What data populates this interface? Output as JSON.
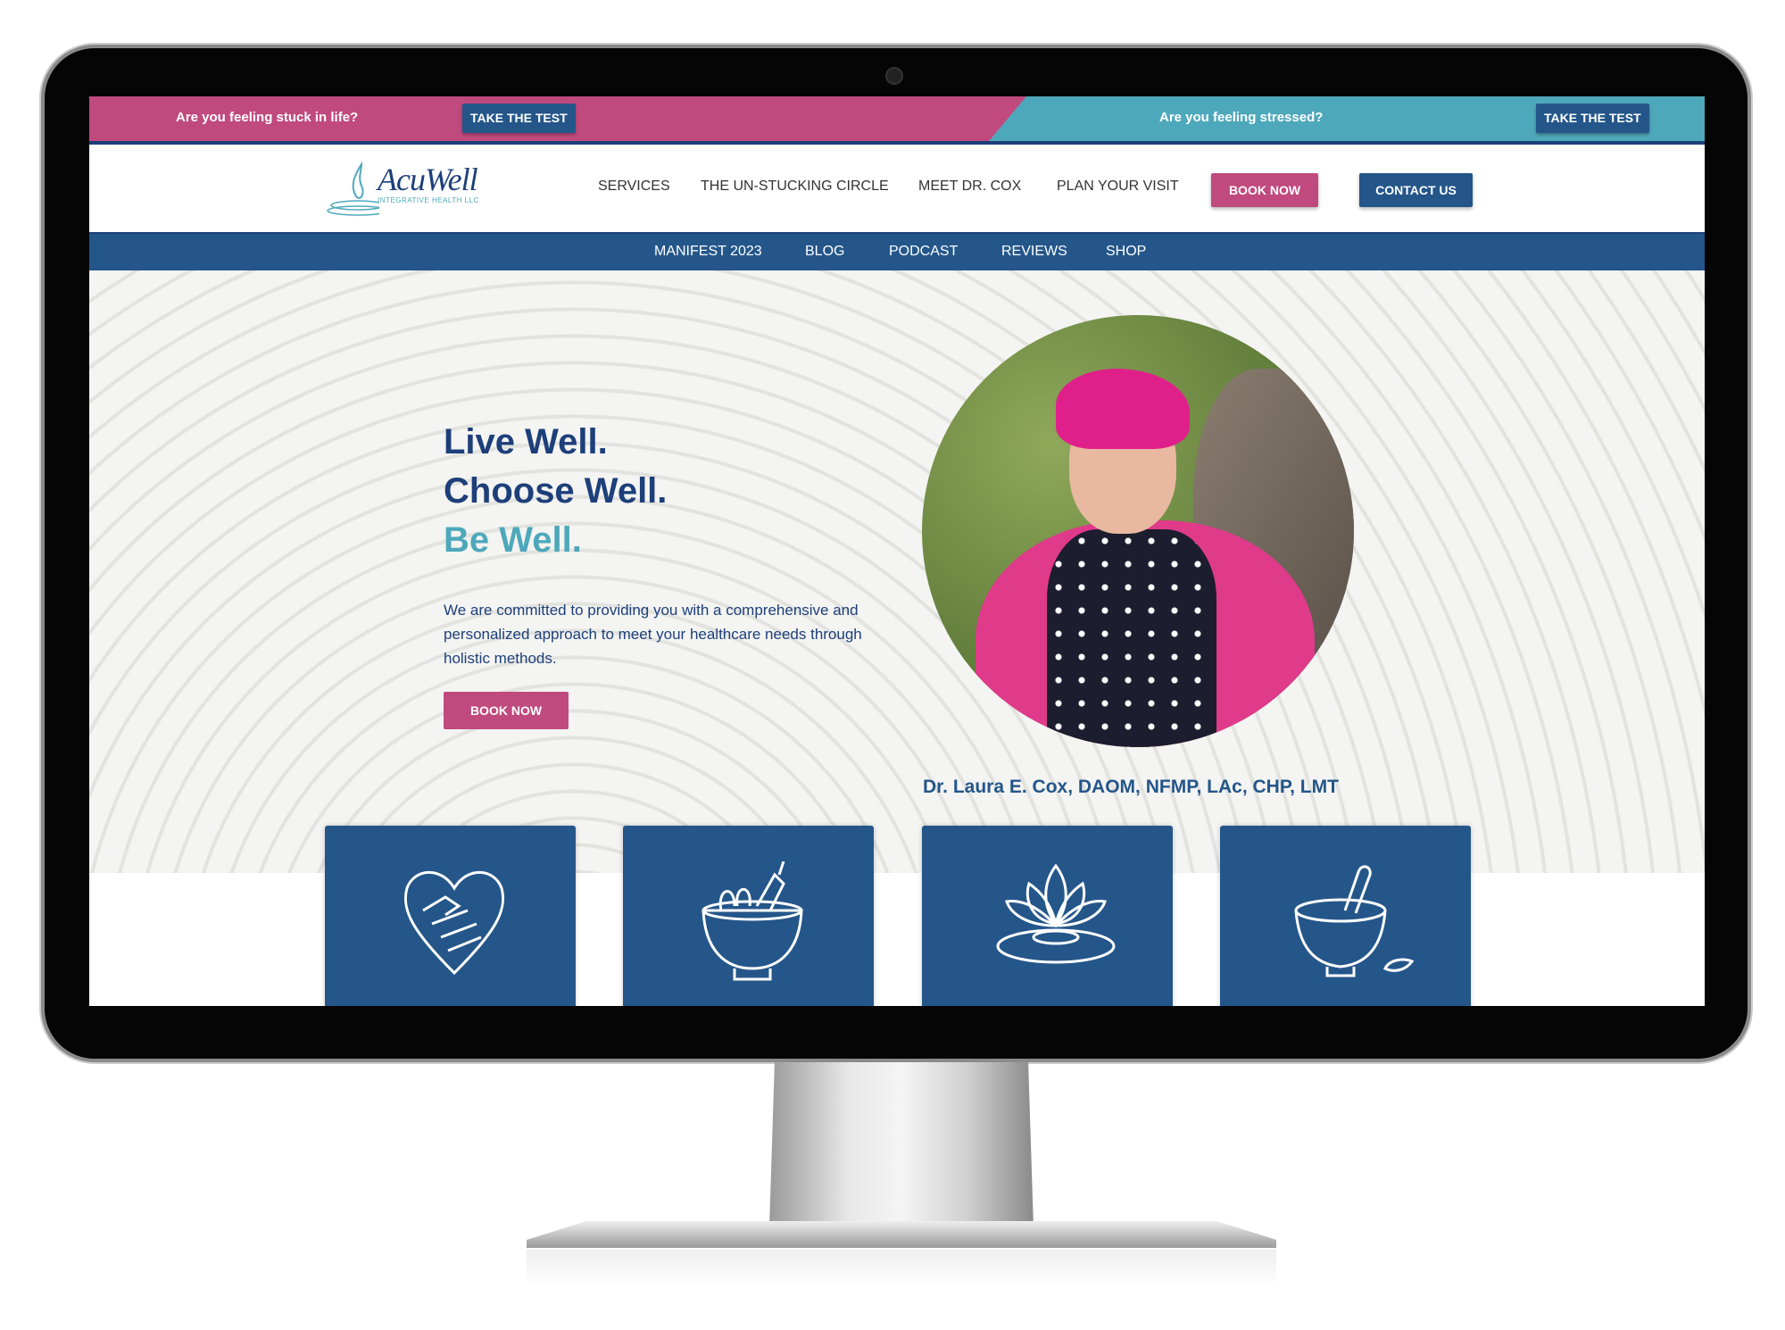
{
  "promo": {
    "left_text": "Are you feeling stuck in life?",
    "left_button": "TAKE THE TEST",
    "right_text": "Are you feeling stressed?",
    "right_button": "TAKE THE TEST"
  },
  "logo": {
    "word": "AcuWell",
    "sub": "INTEGRATIVE HEALTH LLC"
  },
  "nav": {
    "items": [
      "SERVICES",
      "THE UN-STUCKING CIRCLE",
      "MEET DR. COX",
      "PLAN YOUR VISIT"
    ],
    "book_now": "BOOK NOW",
    "contact_us": "CONTACT US"
  },
  "subnav": {
    "items": [
      "MANIFEST 2023",
      "BLOG",
      "PODCAST",
      "REVIEWS",
      "SHOP"
    ]
  },
  "hero": {
    "line1": "Live Well.",
    "line2": "Choose Well.",
    "line3": "Be Well.",
    "description": "We are committed to providing you with a comprehensive and personalized approach to meet your healthcare needs through holistic methods.",
    "button": "BOOK NOW",
    "caption": "Dr. Laura E. Cox, DAOM, NFMP, LAc, CHP, LMT"
  },
  "cards": [
    {
      "icon": "heart-hands-icon"
    },
    {
      "icon": "vegetable-bowl-icon"
    },
    {
      "icon": "lotus-icon"
    },
    {
      "icon": "mortar-pestle-icon"
    }
  ],
  "colors": {
    "pink": "#c04a7e",
    "teal": "#4ea8bb",
    "navy": "#24568a",
    "dark_navy": "#1d3f7a"
  }
}
